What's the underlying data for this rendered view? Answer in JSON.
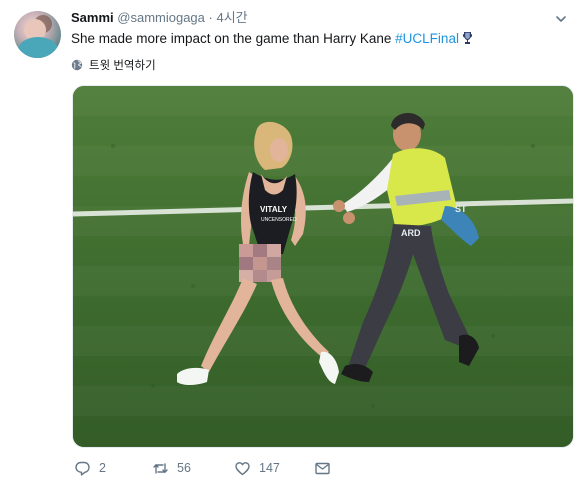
{
  "tweet": {
    "name": "Sammi",
    "handle": "@sammiogaga",
    "separator": "·",
    "time": "4시간",
    "text": "She made more impact on the game than Harry Kane ",
    "hashtag": "#UCLFinal",
    "translate_label": "트윗 번역하기"
  },
  "media": {
    "description_icon": "photo",
    "accent_hashtag_color": "#1b95e0"
  },
  "actions": {
    "reply_count": "2",
    "retweet_count": "56",
    "like_count": "147"
  },
  "icons": {
    "caret": "chevron-down-icon",
    "trophy": "trophy-icon",
    "globe": "globe-icon",
    "reply": "reply-icon",
    "retweet": "retweet-icon",
    "like": "heart-icon",
    "message": "message-icon"
  }
}
